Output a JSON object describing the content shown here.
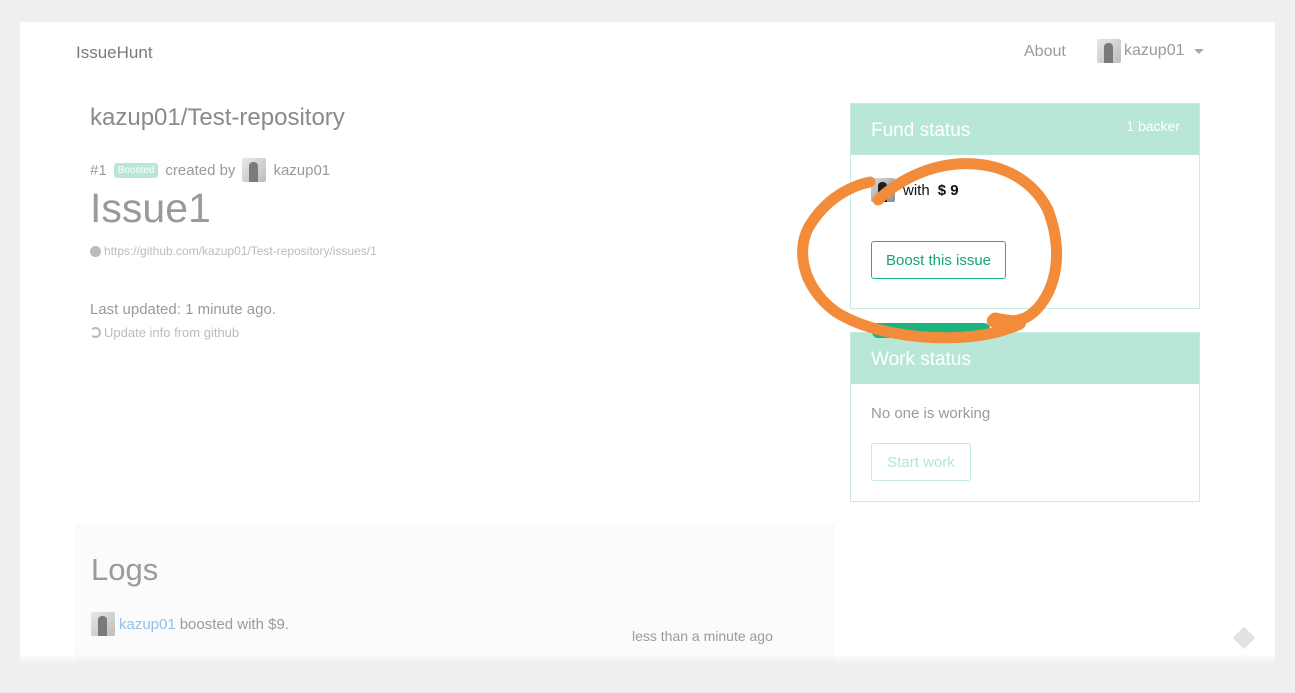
{
  "nav": {
    "brand": "IssueHunt",
    "about": "About",
    "username": "kazup01"
  },
  "issue": {
    "repo": "kazup01/Test-repository",
    "number": "#1",
    "badge": "Boosted",
    "created_by": "created by",
    "author": "kazup01",
    "title": "Issue1",
    "github_url": "https://github.com/kazup01/Test-repository/issues/1",
    "last_updated": "Last updated: 1 minute ago.",
    "update_link": "Update info from github"
  },
  "fund": {
    "title": "Fund status",
    "backers": "1 backer",
    "with_label": "with",
    "amount": "$ 9",
    "boost_button": "Boost this issue"
  },
  "work": {
    "title": "Work status",
    "status": "No one is working",
    "start_button": "Start work"
  },
  "logs": {
    "title": "Logs",
    "entries": [
      {
        "user": "kazup01",
        "action": "boosted with $9.",
        "time": "less than a minute ago"
      }
    ]
  },
  "colors": {
    "accent": "#1bb37e",
    "card_header": "#b9e7d7",
    "annotation": "#f28c3a"
  },
  "icons": [
    "avatar",
    "caret-down-icon",
    "github-icon",
    "refresh-icon",
    "annotation-circle"
  ]
}
